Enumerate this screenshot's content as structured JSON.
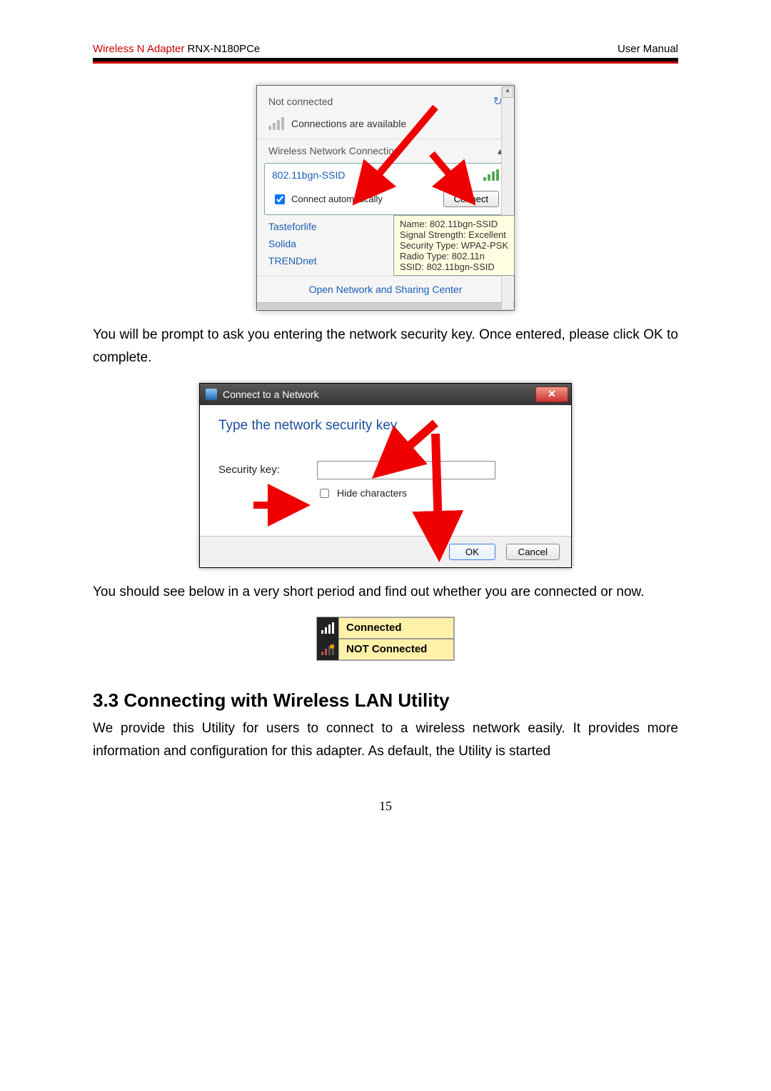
{
  "header": {
    "left_red": "Wireless N Adapter",
    "left_black": " RNX-N180PCe",
    "right": "User Manual"
  },
  "fig1": {
    "not_connected": "Not connected",
    "avail": "Connections are available",
    "sub_header": "Wireless Network Connection",
    "ssid": "802.11bgn-SSID",
    "auto_label": "Connect automatically",
    "connect_btn": "Connect",
    "networks": [
      "Tasteforlife",
      "Solida",
      "TRENDnet"
    ],
    "tooltip": {
      "l1": "Name: 802.11bgn-SSID",
      "l2": "Signal Strength: Excellent",
      "l3": "Security Type: WPA2-PSK",
      "l4": "Radio Type: 802.11n",
      "l5": "SSID: 802.11bgn-SSID"
    },
    "link": "Open Network and Sharing Center"
  },
  "para1": "You will be prompt to ask you entering the network security key. Once entered, please click OK to complete.",
  "fig2": {
    "title": "Connect to a Network",
    "heading": "Type the network security key",
    "sec_label": "Security key:",
    "hide_label": "Hide characters",
    "ok": "OK",
    "cancel": "Cancel"
  },
  "para2": "You should see below in a very short period and find out whether you are connected or now.",
  "fig3": {
    "connected": "Connected",
    "not_connected": "NOT Connected"
  },
  "section": {
    "heading": "3.3 Connecting with Wireless LAN Utility",
    "para": "We provide this Utility for users to connect to a wireless network easily. It provides more information and configuration for this adapter. As default, the Utility is started"
  },
  "page_number": "15"
}
